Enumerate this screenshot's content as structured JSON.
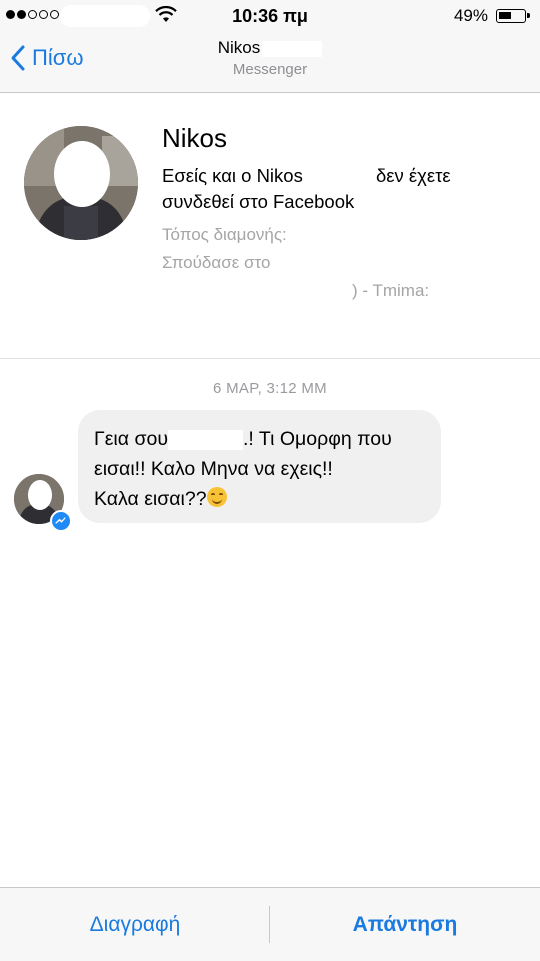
{
  "status_bar": {
    "time": "10:36 πμ",
    "battery": "49%"
  },
  "nav": {
    "back_label": "Πίσω",
    "title": "Nikos",
    "subtitle": "Messenger"
  },
  "profile": {
    "name": "Nikos",
    "relation_before": "Εσείς και ο Nikos",
    "relation_after": "δεν έχετε",
    "relation_line2": "συνδεθεί στο Facebook",
    "residence_label": "Τόπος διαμονής:",
    "studied_label": "Σπούδασε στο",
    "tmima_label": ") - Tmima:"
  },
  "conversation": {
    "timestamp": "6 ΜΑΡ, 3:12 ΜΜ",
    "message_part1": "Γεια σου",
    "message_part2": ".! Τι Ομορφη που",
    "message_line2": "εισαι!! Καλο Μηνα να εχεις!!",
    "message_line3": "Καλα εισαι??"
  },
  "actions": {
    "delete_label": "Διαγραφή",
    "reply_label": "Απάντηση"
  },
  "colors": {
    "accent": "#1b7ae0",
    "bubble": "#f1f0f0",
    "bar_bg": "#f7f7f7"
  }
}
